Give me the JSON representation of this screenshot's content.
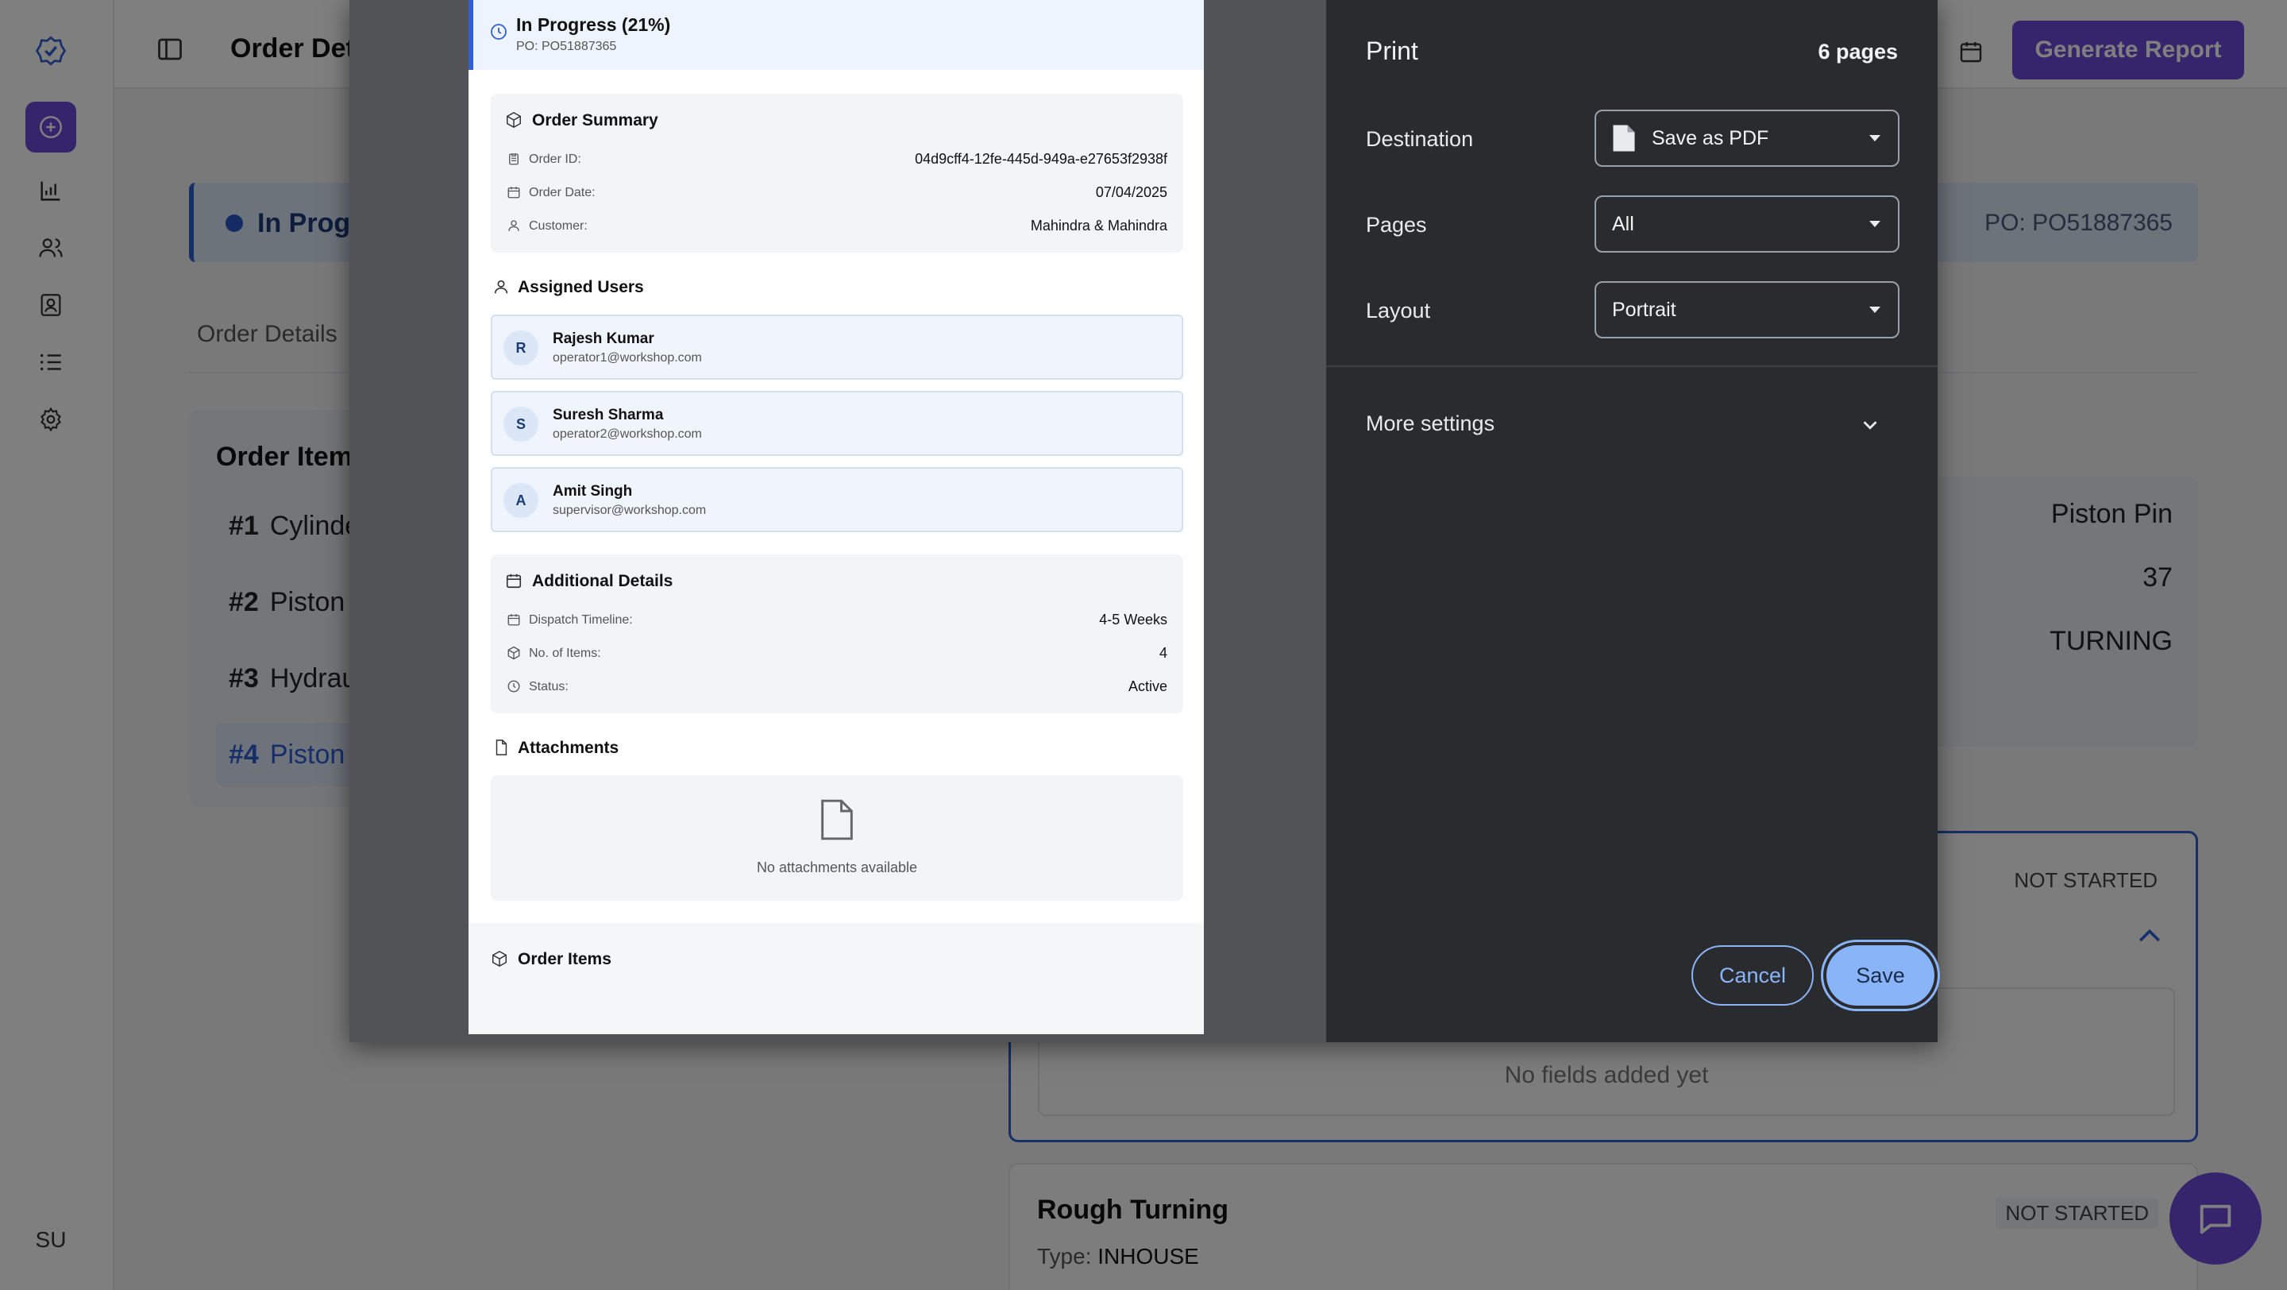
{
  "app": {
    "page_title": "Order Deta",
    "generate_report_label": "Generate Report",
    "user_initials": "SU",
    "status_text": "In Progre",
    "status_po": "PO: PO51887365",
    "tab_order_details": "Order Details",
    "order_items_title": "Order Items",
    "items": [
      {
        "num": "#1",
        "name": "Cylinde"
      },
      {
        "num": "#2",
        "name": "Piston"
      },
      {
        "num": "#3",
        "name": "Hydrau"
      },
      {
        "num": "#4",
        "name": "Piston"
      }
    ],
    "right_values": [
      "Piston Pin",
      "37",
      "TURNING"
    ],
    "operation1": {
      "status": "NOT STARTED",
      "empty_text": "No fields added yet"
    },
    "operation2": {
      "title": "Rough Turning",
      "type_label": "Type:",
      "type_value": "INHOUSE",
      "status": "NOT STARTED"
    }
  },
  "preview": {
    "status": "In Progress (21%)",
    "po": "PO: PO51887365",
    "order_summary": {
      "title": "Order Summary",
      "rows": [
        {
          "label": "Order ID:",
          "value": "04d9cff4-12fe-445d-949a-e27653f2938f"
        },
        {
          "label": "Order Date:",
          "value": "07/04/2025"
        },
        {
          "label": "Customer:",
          "value": "Mahindra & Mahindra"
        }
      ]
    },
    "assigned_users": {
      "title": "Assigned Users",
      "users": [
        {
          "initial": "R",
          "name": "Rajesh Kumar",
          "email": "operator1@workshop.com"
        },
        {
          "initial": "S",
          "name": "Suresh Sharma",
          "email": "operator2@workshop.com"
        },
        {
          "initial": "A",
          "name": "Amit Singh",
          "email": "supervisor@workshop.com"
        }
      ]
    },
    "additional_details": {
      "title": "Additional Details",
      "rows": [
        {
          "label": "Dispatch Timeline:",
          "value": "4-5 Weeks"
        },
        {
          "label": "No. of Items:",
          "value": "4"
        },
        {
          "label": "Status:",
          "value": "Active"
        }
      ]
    },
    "attachments": {
      "title": "Attachments",
      "empty_text": "No attachments available"
    },
    "order_items_title": "Order Items"
  },
  "print": {
    "title": "Print",
    "page_count": "6 pages",
    "destination_label": "Destination",
    "destination_value": "Save as PDF",
    "pages_label": "Pages",
    "pages_value": "All",
    "layout_label": "Layout",
    "layout_value": "Portrait",
    "more_settings": "More settings",
    "cancel_label": "Cancel",
    "save_label": "Save"
  },
  "colors": {
    "accent_purple": "#6d4ad8",
    "accent_blue": "#2f5fd0",
    "dialog_button_blue": "#8ab4f8"
  }
}
